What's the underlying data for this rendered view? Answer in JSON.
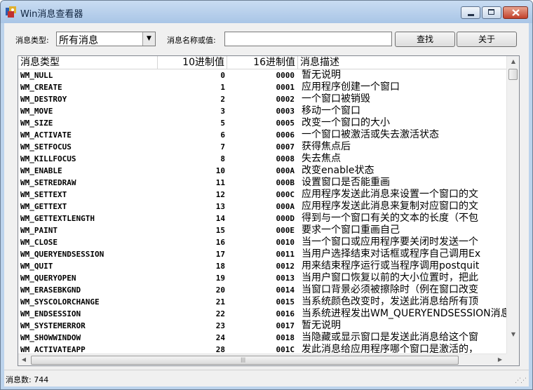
{
  "window": {
    "title": "Win消息查看器"
  },
  "toolbar": {
    "type_label": "消息类型:",
    "type_selected": "所有消息",
    "name_label": "消息名称或值:",
    "name_value": "",
    "find_label": "查找",
    "about_label": "关于"
  },
  "table": {
    "headers": {
      "type": "消息类型",
      "dec": "10进制值",
      "hex": "16进制值",
      "desc": "消息描述"
    },
    "rows": [
      {
        "type": "WM_NULL",
        "dec": "0",
        "hex": "0000",
        "desc": "暂无说明"
      },
      {
        "type": "WM_CREATE",
        "dec": "1",
        "hex": "0001",
        "desc": "应用程序创建一个窗口"
      },
      {
        "type": "WM_DESTROY",
        "dec": "2",
        "hex": "0002",
        "desc": "一个窗口被销毁"
      },
      {
        "type": "WM_MOVE",
        "dec": "3",
        "hex": "0003",
        "desc": "移动一个窗口"
      },
      {
        "type": "WM_SIZE",
        "dec": "5",
        "hex": "0005",
        "desc": "改变一个窗口的大小"
      },
      {
        "type": "WM_ACTIVATE",
        "dec": "6",
        "hex": "0006",
        "desc": "一个窗口被激活或失去激活状态"
      },
      {
        "type": "WM_SETFOCUS",
        "dec": "7",
        "hex": "0007",
        "desc": "获得焦点后"
      },
      {
        "type": "WM_KILLFOCUS",
        "dec": "8",
        "hex": "0008",
        "desc": "失去焦点"
      },
      {
        "type": "WM_ENABLE",
        "dec": "10",
        "hex": "000A",
        "desc": "改变enable状态"
      },
      {
        "type": "WM_SETREDRAW",
        "dec": "11",
        "hex": "000B",
        "desc": "设置窗口是否能重画"
      },
      {
        "type": "WM_SETTEXT",
        "dec": "12",
        "hex": "000C",
        "desc": "应用程序发送此消息来设置一个窗口的文"
      },
      {
        "type": "WM_GETTEXT",
        "dec": "13",
        "hex": "000A",
        "desc": "应用程序发送此消息来复制对应窗口的文"
      },
      {
        "type": "WM_GETTEXTLENGTH",
        "dec": "14",
        "hex": "000D",
        "desc": "得到与一个窗口有关的文本的长度（不包"
      },
      {
        "type": "WM_PAINT",
        "dec": "15",
        "hex": "000E",
        "desc": "要求一个窗口重画自己"
      },
      {
        "type": "WM_CLOSE",
        "dec": "16",
        "hex": "0010",
        "desc": "当一个窗口或应用程序要关闭时发送一个"
      },
      {
        "type": "WM_QUERYENDSESSION",
        "dec": "17",
        "hex": "0011",
        "desc": "当用户选择结束对话框或程序自己调用Ex"
      },
      {
        "type": "WM_QUIT",
        "dec": "18",
        "hex": "0012",
        "desc": "用来结束程序运行或当程序调用postquit"
      },
      {
        "type": "WM_QUERYOPEN",
        "dec": "19",
        "hex": "0013",
        "desc": "当用户窗口恢复以前的大小位置时，把此"
      },
      {
        "type": "WM_ERASEBKGND",
        "dec": "20",
        "hex": "0014",
        "desc": "当窗口背景必须被擦除时（例在窗口改变"
      },
      {
        "type": "WM_SYSCOLORCHANGE",
        "dec": "21",
        "hex": "0015",
        "desc": "当系统颜色改变时，发送此消息给所有顶"
      },
      {
        "type": "WM_ENDSESSION",
        "dec": "22",
        "hex": "0016",
        "desc": "当系统进程发出WM_QUERYENDSESSION消息"
      },
      {
        "type": "WM_SYSTEMERROR",
        "dec": "23",
        "hex": "0017",
        "desc": "暂无说明"
      },
      {
        "type": "WM_SHOWWINDOW",
        "dec": "24",
        "hex": "0018",
        "desc": "当隐藏或显示窗口是发送此消息给这个窗"
      },
      {
        "type": "WM_ACTIVATEAPP",
        "dec": "28",
        "hex": "001C",
        "desc": "发此消息给应用程序哪个窗口是激活的，"
      }
    ]
  },
  "status": {
    "text": "消息数: 744"
  }
}
